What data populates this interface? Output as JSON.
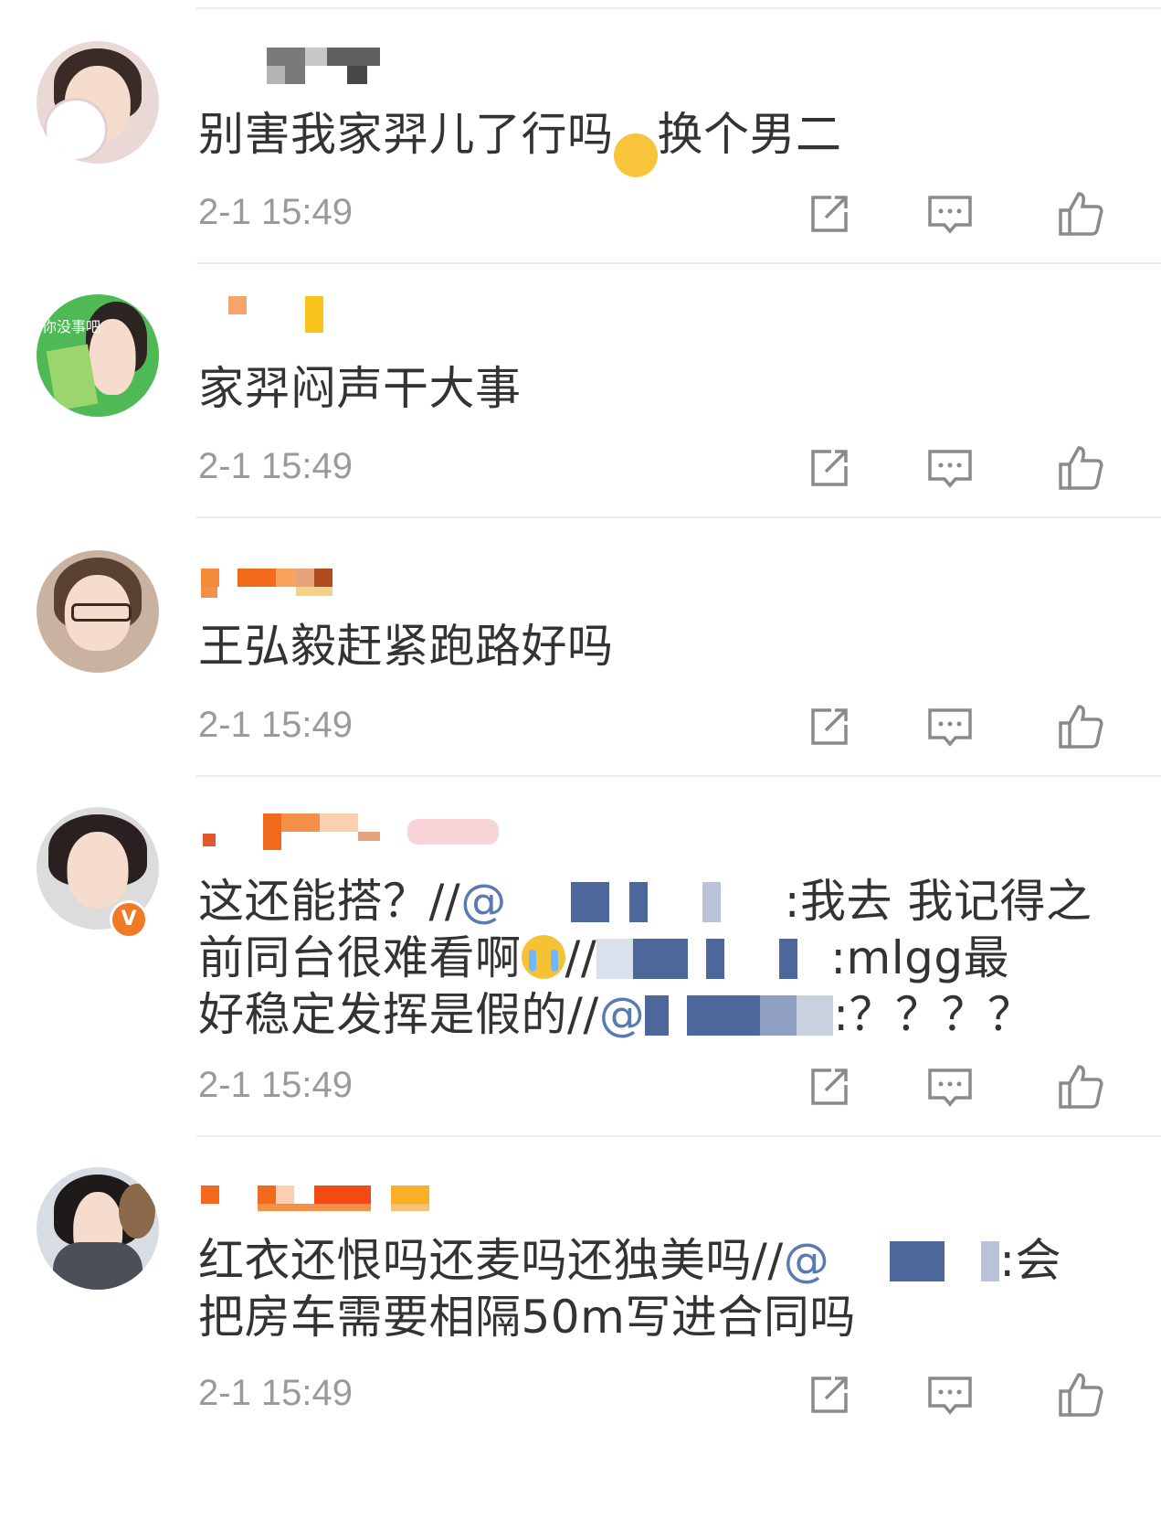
{
  "comments": [
    {
      "text_parts": [
        "别害我家羿儿了行吗",
        "换个男二"
      ],
      "emoji": "thinking-emoji",
      "time": "2-1 15:49"
    },
    {
      "avatar_tag": "你没事吧",
      "text": "家羿闷声干大事",
      "time": "2-1 15:49"
    },
    {
      "text": "王弘毅赶紧跑路好吗",
      "time": "2-1 15:49"
    },
    {
      "line1_a": "这还能搭？//",
      "line1_b": "@",
      "line1_c": ":我去 我记得之",
      "line2_a": "前同台很难看啊",
      "line2_b": "//",
      "line2_c": ":mlgg最",
      "line3_a": "好稳定发挥是假的//",
      "line3_b": "@",
      "line3_c": ":？？？？",
      "emoji": "crying-emoji",
      "time": "2-1 15:49"
    },
    {
      "line1_a": "红衣还恨吗还麦吗还独美吗//",
      "line1_b": "@",
      "line1_c": ":会",
      "line2": "把房车需要相隔50m写进合同吗",
      "time": "2-1 15:49"
    }
  ],
  "colors": {
    "text": "#333333",
    "time": "#9a9a9a",
    "mention": "#5b7ab3",
    "icon": "#8a8a8a",
    "divider": "#ececec",
    "verified_badge": "#f07a26"
  },
  "icons": [
    "share-icon",
    "comment-icon",
    "like-icon"
  ]
}
